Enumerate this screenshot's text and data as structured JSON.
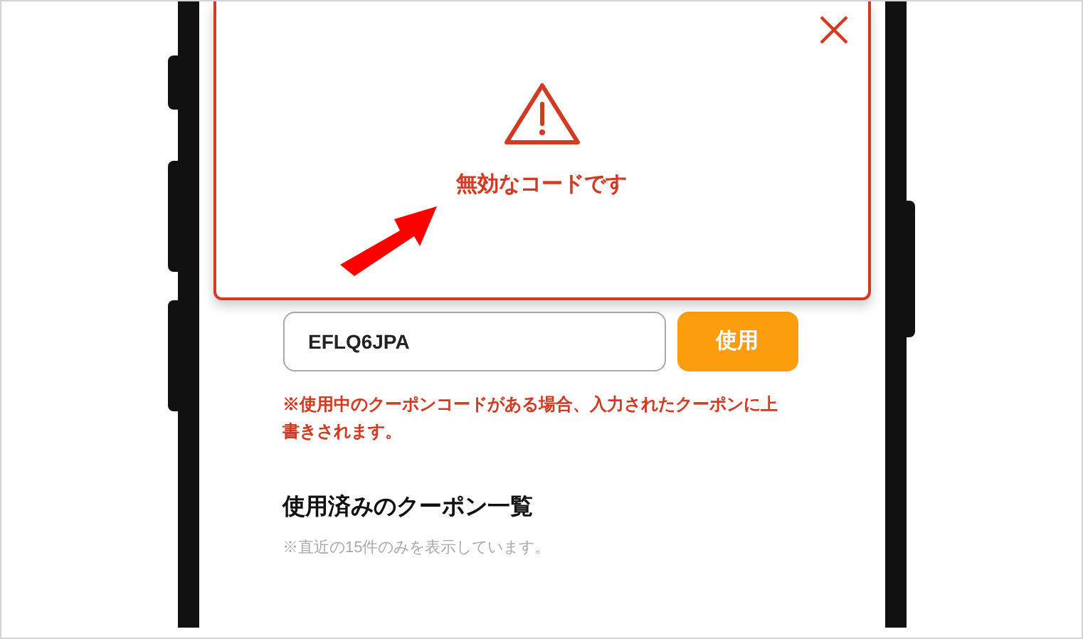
{
  "dialog": {
    "message": "無効なコードです"
  },
  "coupon_field": {
    "value": "EFLQ6JPA"
  },
  "apply_button": {
    "label": "使用"
  },
  "overwrite_note": "※使用中のクーポンコードがある場合、入力されたクーポンに上書きされます。",
  "used_coupons": {
    "heading": "使用済みのクーポン一覧",
    "note": "※直近の15件のみを表示しています。"
  }
}
